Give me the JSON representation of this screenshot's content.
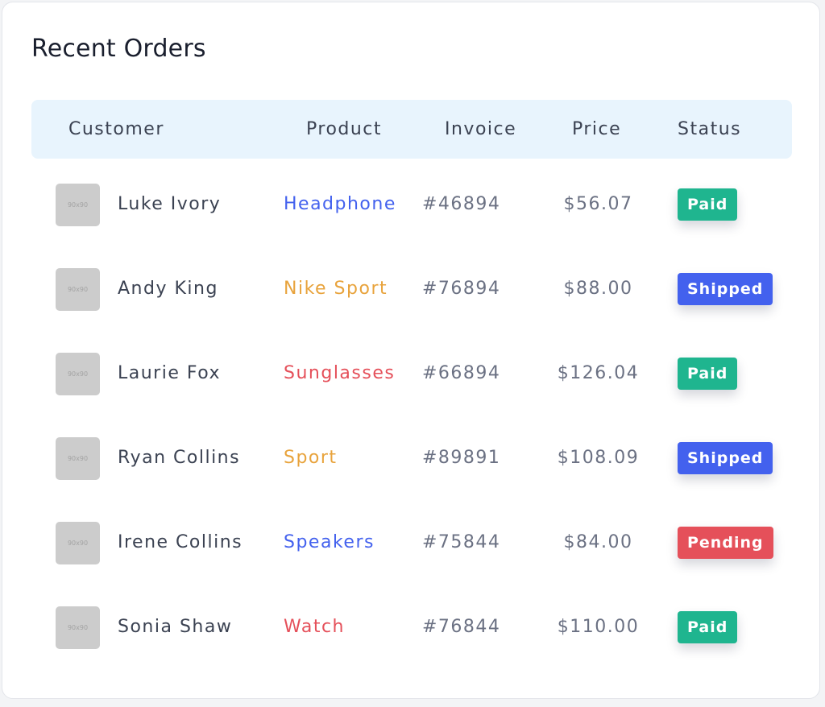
{
  "title": "Recent Orders",
  "avatar_placeholder": "90x90",
  "columns": [
    "Customer",
    "Product",
    "Invoice",
    "Price",
    "Status"
  ],
  "status_colors": {
    "Paid": "#1fb58f",
    "Shipped": "#4361ee",
    "Pending": "#e5505a"
  },
  "orders": [
    {
      "customer": "Luke Ivory",
      "product": "Headphone",
      "product_color": "#4361ee",
      "invoice": "#46894",
      "price": "$56.07",
      "status": "Paid"
    },
    {
      "customer": "Andy King",
      "product": "Nike Sport",
      "product_color": "#e8a33c",
      "invoice": "#76894",
      "price": "$88.00",
      "status": "Shipped"
    },
    {
      "customer": "Laurie Fox",
      "product": "Sunglasses",
      "product_color": "#e5505a",
      "invoice": "#66894",
      "price": "$126.04",
      "status": "Paid"
    },
    {
      "customer": "Ryan Collins",
      "product": "Sport",
      "product_color": "#e8a33c",
      "invoice": "#89891",
      "price": "$108.09",
      "status": "Shipped"
    },
    {
      "customer": "Irene Collins",
      "product": "Speakers",
      "product_color": "#4361ee",
      "invoice": "#75844",
      "price": "$84.00",
      "status": "Pending"
    },
    {
      "customer": "Sonia Shaw",
      "product": "Watch",
      "product_color": "#e5505a",
      "invoice": "#76844",
      "price": "$110.00",
      "status": "Paid"
    }
  ]
}
